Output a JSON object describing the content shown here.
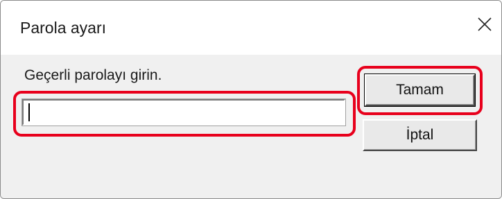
{
  "dialog": {
    "title": "Parola ayarı",
    "prompt": "Geçerli parolayı girin.",
    "password_value": "",
    "ok_label": "Tamam",
    "cancel_label": "İptal",
    "close_icon": "close-icon",
    "highlight_color": "#e8001c"
  }
}
